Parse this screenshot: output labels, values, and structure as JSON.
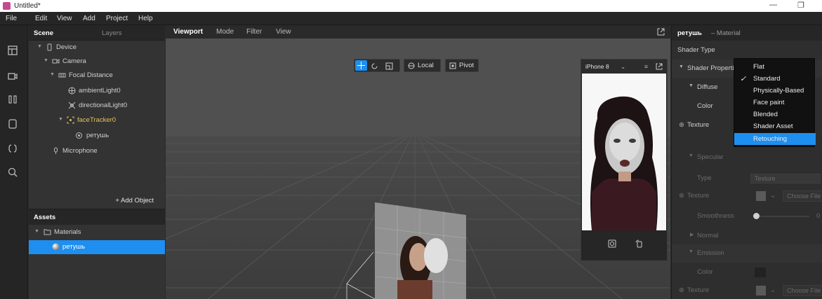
{
  "window": {
    "title": "Untitled*",
    "minimize": "—",
    "restore": "❐"
  },
  "menu": [
    "File",
    "Edit",
    "View",
    "Add",
    "Project",
    "Help"
  ],
  "scene": {
    "tab_active": "Scene",
    "tab_inactive": "Layers",
    "tree": [
      {
        "label": "Device",
        "icon": "device-icon"
      },
      {
        "label": "Camera",
        "icon": "camera-icon"
      },
      {
        "label": "Focal Distance",
        "icon": "focal-distance-icon"
      },
      {
        "label": "ambientLight0",
        "icon": "ambient-light-icon"
      },
      {
        "label": "directionalLight0",
        "icon": "directional-light-icon"
      },
      {
        "label": "faceTracker0",
        "icon": "face-tracker-icon"
      },
      {
        "label": "ретушь",
        "icon": "mesh-icon"
      },
      {
        "label": "Microphone",
        "icon": "microphone-icon"
      }
    ],
    "add_object": "+ Add Object"
  },
  "assets": {
    "title": "Assets",
    "folder": "Materials",
    "selected_item": "ретушь"
  },
  "viewport": {
    "tabs": [
      "Viewport",
      "Mode",
      "Filter",
      "View"
    ],
    "gizmo_local": "Local",
    "gizmo_pivot": "Pivot",
    "device_name": "iPhone 8"
  },
  "inspector": {
    "object_name": "ретушь",
    "object_type": "– Material",
    "shader_type_label": "Shader Type",
    "shader_properties_label": "Shader Properti",
    "diffuse": "Diffuse",
    "color": "Color",
    "texture": "Texture",
    "specular": "Specular",
    "type": "Type",
    "type_value": "Texture",
    "choose_file": "Choose File",
    "smoothness": "Smoothness",
    "smoothness_value": "0",
    "normal": "Normal",
    "emission": "Emission",
    "emission_color": "Color"
  },
  "shader_dropdown": {
    "options": [
      "Flat",
      "Standard",
      "Physically-Based",
      "Face paint",
      "Blended",
      "Shader Asset",
      "Retouching"
    ],
    "checked": "Standard",
    "highlighted": "Retouching"
  },
  "colors": {
    "accent": "#1e8ff0",
    "highlight_text": "#e2c15a"
  }
}
